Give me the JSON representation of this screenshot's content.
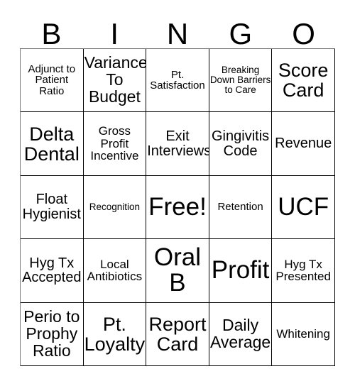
{
  "card": {
    "header_letters": [
      "B",
      "I",
      "N",
      "G",
      "O"
    ],
    "colors": {
      "background": "#ffffff",
      "text": "#000000",
      "grid_line": "#000000",
      "outer_line": "#7b7b7b"
    },
    "grid": {
      "columns": 5,
      "rows": 5,
      "cells": [
        [
          {
            "text": "Adjunct to Patient Ratio",
            "size": "xs"
          },
          {
            "text": "Variance To Budget",
            "size": "ml"
          },
          {
            "text": "Pt. Satisfaction",
            "size": "xs"
          },
          {
            "text": "Breaking Down Barriers to Care",
            "size": "xxs"
          },
          {
            "text": "Score Card",
            "size": "lg"
          }
        ],
        [
          {
            "text": "Delta Dental",
            "size": "lg"
          },
          {
            "text": "Gross Profit Incentive",
            "size": "sm"
          },
          {
            "text": "Exit Interviews",
            "size": "md"
          },
          {
            "text": "Gingivitis Code",
            "size": "md"
          },
          {
            "text": "Revenue",
            "size": "md"
          }
        ],
        [
          {
            "text": "Float Hygienist",
            "size": "md"
          },
          {
            "text": "Recognition",
            "size": "xxs"
          },
          {
            "text": "Free!",
            "size": "xxl"
          },
          {
            "text": "Retention",
            "size": "xs"
          },
          {
            "text": "UCF",
            "size": "xxl"
          }
        ],
        [
          {
            "text": "Hyg Tx Accepted",
            "size": "md"
          },
          {
            "text": "Local Antibiotics",
            "size": "sm"
          },
          {
            "text": "Oral B",
            "size": "xxl"
          },
          {
            "text": "Profit",
            "size": "xxl"
          },
          {
            "text": "Hyg Tx Presented",
            "size": "sm"
          }
        ],
        [
          {
            "text": "Perio to Prophy Ratio",
            "size": "ml"
          },
          {
            "text": "Pt. Loyalty",
            "size": "lg"
          },
          {
            "text": "Report Card",
            "size": "lg"
          },
          {
            "text": "Daily Average",
            "size": "ml"
          },
          {
            "text": "Whitening",
            "size": "sm"
          }
        ]
      ]
    }
  }
}
